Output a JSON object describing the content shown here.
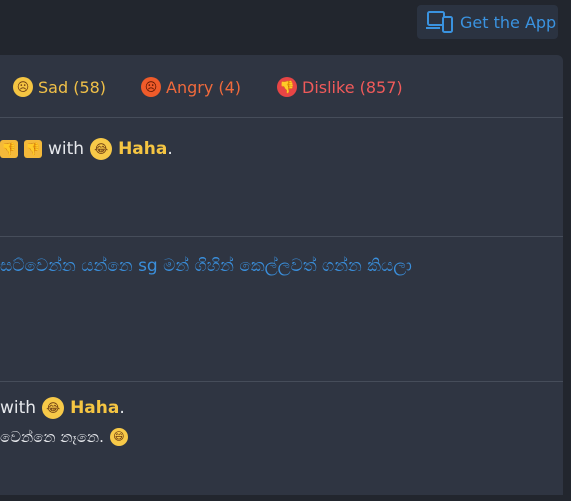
{
  "header": {
    "get_app_label": "Get the App"
  },
  "reactions": [
    {
      "label": "Sad (58)",
      "icon": "sad-face-icon",
      "color": "#f0c048"
    },
    {
      "label": "Angry (4)",
      "icon": "angry-face-icon",
      "color": "#f06a3c"
    },
    {
      "label": "Dislike (857)",
      "icon": "dislike-icon",
      "color": "#f05a5a"
    }
  ],
  "comments": [
    {
      "with_text": "with",
      "reaction": "Haha",
      "trail": "."
    },
    {
      "text": "සට්වෙන්න යන්නෙ sg මන් ගිහින් කෙල්ලවත් ගන්න කියලා"
    },
    {
      "with_text": "with",
      "reaction": "Haha",
      "trail": ".",
      "body": "වෙන්නෙ නෑනෙ."
    }
  ],
  "colors": {
    "accent": "#3a93e0",
    "haha": "#f5c542",
    "panel": "#2f3542",
    "bg": "#22262e"
  }
}
